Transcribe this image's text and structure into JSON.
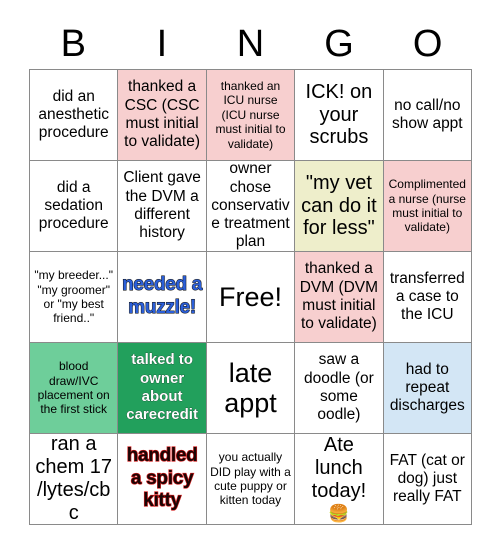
{
  "header": {
    "letters": [
      "B",
      "I",
      "N",
      "G",
      "O"
    ]
  },
  "grid": {
    "rows": 5,
    "columns": 5,
    "cells": [
      {
        "text": "did an anesthetic procedure",
        "bg": "#ffffff",
        "bg_class": "bg-white",
        "size": "sz-md",
        "style": "",
        "marked": false,
        "emoji": ""
      },
      {
        "text": "thanked a CSC (CSC must initial to validate)",
        "bg": "#f7cfcf",
        "bg_class": "bg-pink",
        "size": "sz-md",
        "style": "",
        "marked": false,
        "emoji": ""
      },
      {
        "text": "thanked an ICU nurse (ICU nurse must initial to validate)",
        "bg": "#f7cfcf",
        "bg_class": "bg-pink",
        "size": "sz-sm",
        "style": "",
        "marked": false,
        "emoji": ""
      },
      {
        "text": "ICK! on your scrubs",
        "bg": "#ffffff",
        "bg_class": "bg-white",
        "size": "sz-lg",
        "style": "",
        "marked": false,
        "emoji": ""
      },
      {
        "text": "no call/no show appt",
        "bg": "#ffffff",
        "bg_class": "bg-white",
        "size": "sz-md",
        "style": "",
        "marked": false,
        "emoji": ""
      },
      {
        "text": "did a sedation procedure",
        "bg": "#ffffff",
        "bg_class": "bg-white",
        "size": "sz-md",
        "style": "",
        "marked": false,
        "emoji": ""
      },
      {
        "text": "Client gave the DVM a different history",
        "bg": "#ffffff",
        "bg_class": "bg-white",
        "size": "sz-md",
        "style": "",
        "marked": false,
        "emoji": ""
      },
      {
        "text": "owner chose conservative treatment plan",
        "bg": "#ffffff",
        "bg_class": "bg-white",
        "size": "sz-md",
        "style": "",
        "marked": false,
        "emoji": ""
      },
      {
        "text": "\"my vet can do it for less\"",
        "bg": "#eeeecb",
        "bg_class": "bg-yellow",
        "size": "sz-lg",
        "style": "",
        "marked": false,
        "emoji": ""
      },
      {
        "text": "Complimented a nurse (nurse must initial to validate)",
        "bg": "#f7cfcf",
        "bg_class": "bg-pink",
        "size": "sz-sm",
        "style": "",
        "marked": false,
        "emoji": ""
      },
      {
        "text": "\"my breeder...\" \"my groomer\" or \"my best friend..\"",
        "bg": "#ffffff",
        "bg_class": "bg-white",
        "size": "sz-sm",
        "style": "",
        "marked": false,
        "emoji": ""
      },
      {
        "text": "needed a muzzle!",
        "bg": "#ffffff",
        "bg_class": "bg-white",
        "size": "sz-lg",
        "style": "style-blue-outline",
        "marked": true,
        "emoji": ""
      },
      {
        "text": "Free!",
        "bg": "#ffffff",
        "bg_class": "bg-white",
        "size": "sz-xl",
        "style": "",
        "marked": false,
        "emoji": ""
      },
      {
        "text": "thanked a DVM (DVM must initial to validate)",
        "bg": "#f7cfcf",
        "bg_class": "bg-pink",
        "size": "sz-md",
        "style": "",
        "marked": false,
        "emoji": ""
      },
      {
        "text": "transferred a case to the ICU",
        "bg": "#ffffff",
        "bg_class": "bg-white",
        "size": "sz-md",
        "style": "",
        "marked": false,
        "emoji": ""
      },
      {
        "text": "blood draw/IVC placement on the first stick",
        "bg": "#6ece9a",
        "bg_class": "bg-green-light",
        "size": "sz-sm",
        "style": "",
        "marked": true,
        "emoji": ""
      },
      {
        "text": "talked to owner about carecredit",
        "bg": "#22a05c",
        "bg_class": "bg-green-dark",
        "size": "sz-md",
        "style": "style-white-outline",
        "marked": true,
        "emoji": ""
      },
      {
        "text": "late appt",
        "bg": "#ffffff",
        "bg_class": "bg-white",
        "size": "sz-xl",
        "style": "",
        "marked": false,
        "emoji": ""
      },
      {
        "text": "saw a doodle (or some oodle)",
        "bg": "#ffffff",
        "bg_class": "bg-white",
        "size": "sz-md",
        "style": "",
        "marked": false,
        "emoji": ""
      },
      {
        "text": "had to repeat discharges",
        "bg": "#d3e6f5",
        "bg_class": "bg-blue-light",
        "size": "sz-md",
        "style": "",
        "marked": true,
        "emoji": ""
      },
      {
        "text": "ran a chem 17 /lytes/cbc",
        "bg": "#ffffff",
        "bg_class": "bg-white",
        "size": "sz-lg",
        "style": "",
        "marked": false,
        "emoji": ""
      },
      {
        "text": "handled a spicy kitty",
        "bg": "#ffffff",
        "bg_class": "bg-white",
        "size": "sz-lg",
        "style": "style-red-outline",
        "marked": true,
        "emoji": ""
      },
      {
        "text": "you actually DID play with a cute puppy or kitten today",
        "bg": "#ffffff",
        "bg_class": "bg-white",
        "size": "sz-sm",
        "style": "",
        "marked": false,
        "emoji": ""
      },
      {
        "text": "Ate lunch today!",
        "bg": "#ffffff",
        "bg_class": "bg-white",
        "size": "sz-lg",
        "style": "",
        "marked": false,
        "emoji": "🍔"
      },
      {
        "text": "FAT (cat or dog) just really FAT",
        "bg": "#ffffff",
        "bg_class": "bg-white",
        "size": "sz-md",
        "style": "",
        "marked": false,
        "emoji": ""
      }
    ]
  },
  "colors": {
    "border": "#8a8a8a",
    "text": "#000000",
    "pink": "#f7cfcf",
    "yellow": "#eeeecb",
    "green_light": "#6ece9a",
    "green_dark": "#22a05c",
    "blue_light": "#d3e6f5",
    "accent_blue_text": "#2b5fd9",
    "accent_red_text": "#d21d1d"
  }
}
